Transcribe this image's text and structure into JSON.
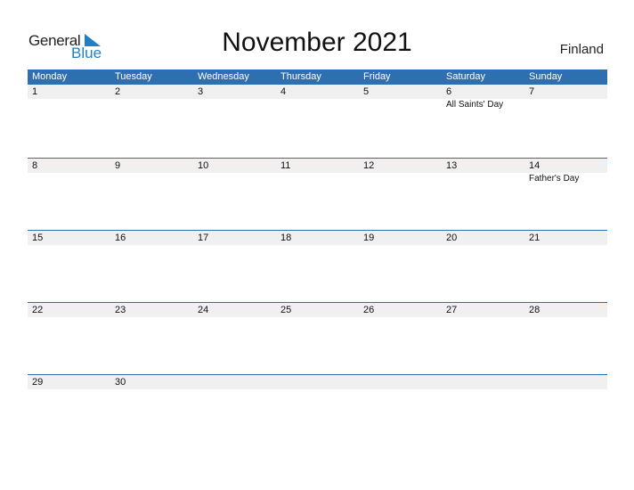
{
  "logo": {
    "part1": "General",
    "part2": "Blue",
    "icon": "triangle-flag-icon",
    "accent": "#1f7fc9"
  },
  "title": "November 2021",
  "country": "Finland",
  "header_color": "#2e6fb1",
  "weekdays": [
    "Monday",
    "Tuesday",
    "Wednesday",
    "Thursday",
    "Friday",
    "Saturday",
    "Sunday"
  ],
  "weeks": [
    {
      "days": [
        "1",
        "2",
        "3",
        "4",
        "5",
        "6",
        "7"
      ],
      "holidays": [
        "",
        "",
        "",
        "",
        "",
        "All Saints' Day",
        ""
      ]
    },
    {
      "days": [
        "8",
        "9",
        "10",
        "11",
        "12",
        "13",
        "14"
      ],
      "holidays": [
        "",
        "",
        "",
        "",
        "",
        "",
        "Father's Day"
      ]
    },
    {
      "days": [
        "15",
        "16",
        "17",
        "18",
        "19",
        "20",
        "21"
      ],
      "holidays": [
        "",
        "",
        "",
        "",
        "",
        "",
        ""
      ]
    },
    {
      "days": [
        "22",
        "23",
        "24",
        "25",
        "26",
        "27",
        "28"
      ],
      "holidays": [
        "",
        "",
        "",
        "",
        "",
        "",
        ""
      ]
    },
    {
      "days": [
        "29",
        "30",
        "",
        "",
        "",
        "",
        ""
      ],
      "holidays": [
        "",
        "",
        "",
        "",
        "",
        "",
        ""
      ]
    }
  ]
}
